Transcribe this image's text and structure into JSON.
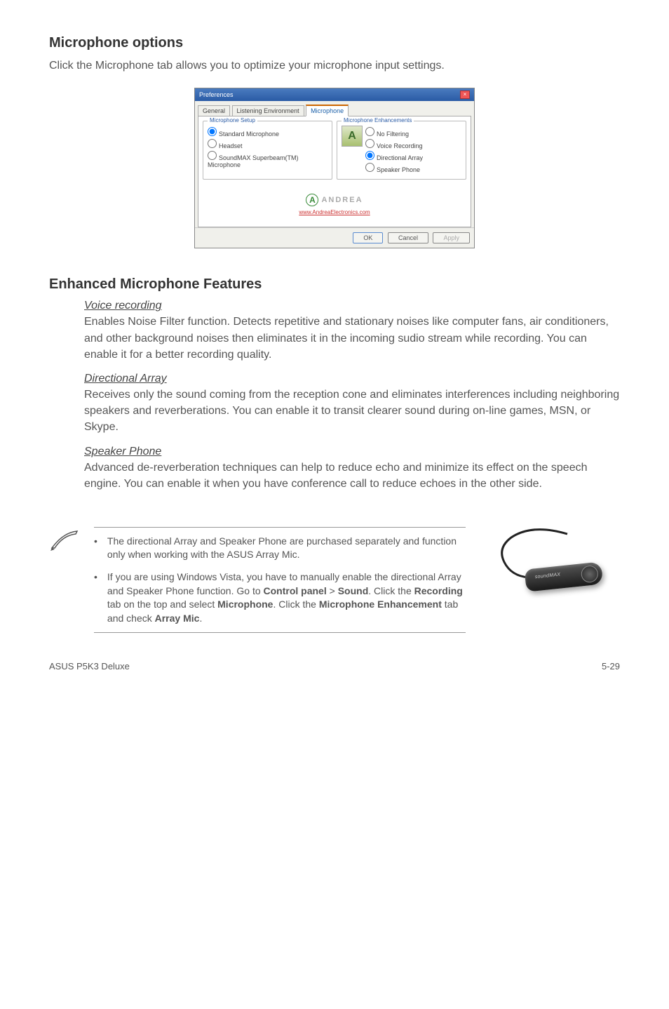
{
  "sections": {
    "mic_options": {
      "title": "Microphone options",
      "desc": "Click the Microphone tab allows you to optimize your microphone input settings."
    },
    "enhanced": {
      "title": "Enhanced Microphone Features",
      "features": [
        {
          "title": "Voice recording",
          "desc": "Enables Noise Filter function. Detects repetitive and stationary noises like computer fans, air conditioners, and other background noises then eliminates it in the incoming sudio stream while recording. You can enable it for a better recording quality."
        },
        {
          "title": "Directional Array",
          "desc": "Receives only the sound coming from the reception cone and eliminates interferences including neighboring speakers and reverberations. You can enable it to transit clearer sound during on-line games, MSN, or Skype."
        },
        {
          "title": "Speaker Phone",
          "desc": "Advanced de-reverberation techniques can help to reduce echo and minimize its effect on the speech engine. You can enable it when you have conference call to reduce echoes in the other side."
        }
      ]
    }
  },
  "dialog": {
    "title": "Preferences",
    "tabs": [
      "General",
      "Listening Environment",
      "Microphone"
    ],
    "active_tab": 2,
    "setup_group": {
      "legend": "Microphone Setup",
      "options": [
        "Standard Microphone",
        "Headset",
        "SoundMAX Superbeam(TM) Microphone"
      ],
      "selected": 0
    },
    "enhance_group": {
      "legend": "Microphone Enhancements",
      "options": [
        "No Filtering",
        "Voice Recording",
        "Directional Array",
        "Speaker Phone"
      ],
      "selected": 2
    },
    "logo_text": "ANDREA",
    "logo_link": "www.AndreaElectronics.com",
    "buttons": {
      "ok": "OK",
      "cancel": "Cancel",
      "apply": "Apply"
    }
  },
  "notes": [
    {
      "text_parts": [
        "The directional Array and Speaker Phone are purchased separately and function only when working with the ASUS Array Mic."
      ]
    },
    {
      "text_parts": [
        "If you are using Windows Vista, you have to manually enable the directional Array and Speaker Phone function. Go to ",
        "Control panel",
        " > ",
        "Sound",
        ". Click the ",
        "Recording",
        " tab on the top and select ",
        "Microphone",
        ". Click the ",
        "Microphone Enhancement",
        " tab and check ",
        "Array Mic",
        "."
      ],
      "bold_indices": [
        1,
        3,
        5,
        7,
        9,
        11
      ]
    }
  ],
  "device_label": "soundMAX",
  "footer": {
    "left": "ASUS P5K3 Deluxe",
    "right": "5-29"
  }
}
